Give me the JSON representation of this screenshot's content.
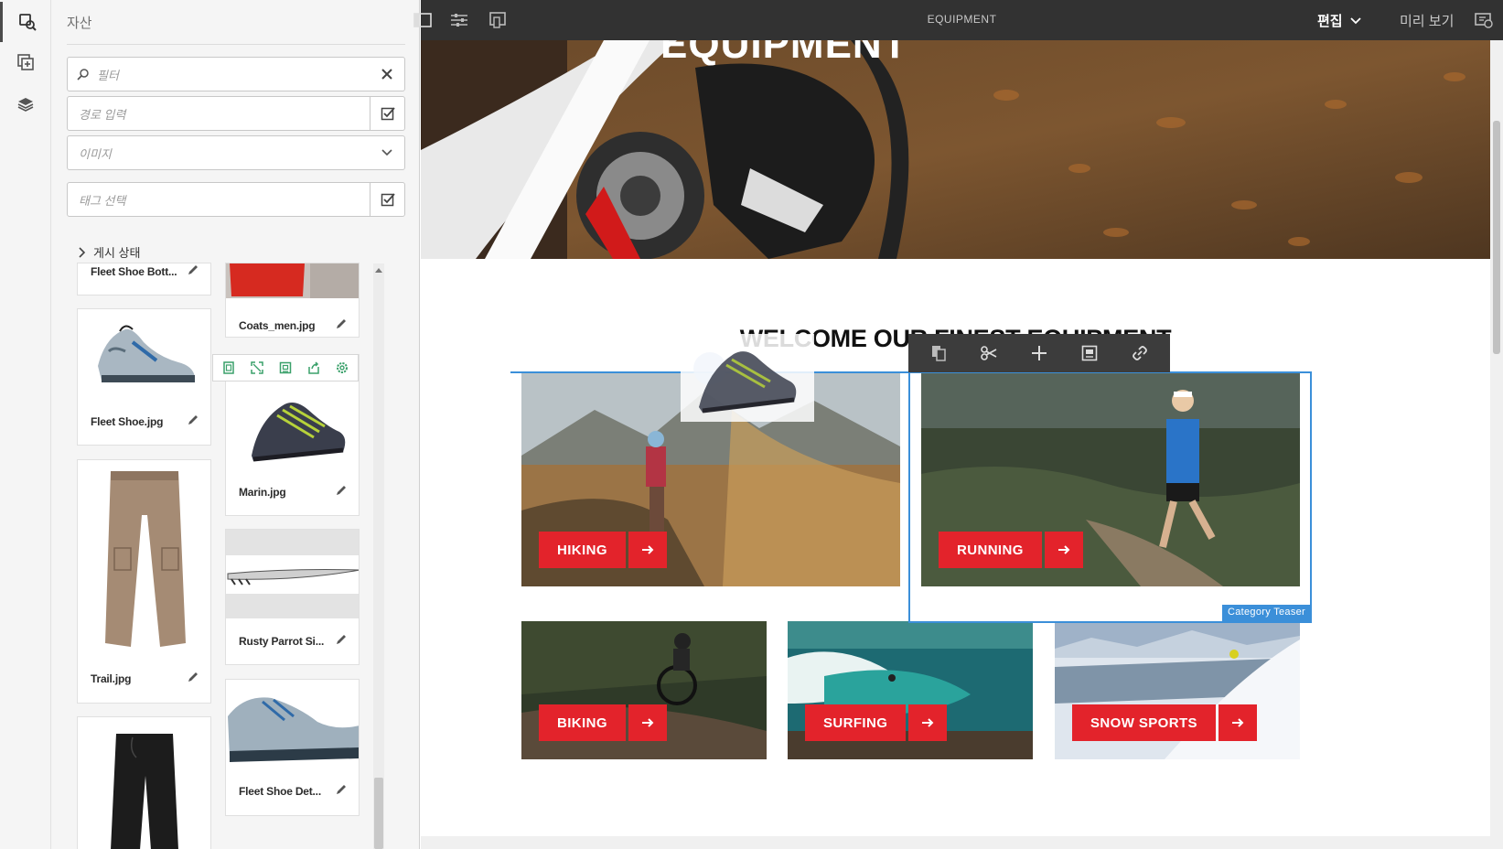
{
  "rail": {
    "items": [
      {
        "name": "assets-icon",
        "active": true
      },
      {
        "name": "components-icon",
        "active": false
      },
      {
        "name": "content-tree-icon",
        "active": false
      }
    ]
  },
  "panel": {
    "title": "자산",
    "filter_placeholder": "필터",
    "path_placeholder": "경로 입력",
    "type_select_value": "이미지",
    "tag_placeholder": "태그 선택",
    "publish_status_label": "게시 상태",
    "assets_left": [
      {
        "label": "Fleet Shoe Bott..."
      },
      {
        "label": "Fleet Shoe.jpg"
      },
      {
        "label": "Trail.jpg"
      },
      {
        "label": ""
      }
    ],
    "assets_right": [
      {
        "label": "Coats_men.jpg"
      },
      {
        "label": "Marin.jpg"
      },
      {
        "label": "Rusty Parrot Si..."
      },
      {
        "label": "Fleet Shoe Det..."
      }
    ]
  },
  "topbar": {
    "page_title": "EQUIPMENT",
    "mode_label": "편집",
    "preview_label": "미리 보기"
  },
  "page": {
    "hero_title": "EQUIPMENT",
    "section_title": "WELCOME OUR FINEST EQUIPMENT",
    "teasers": [
      {
        "label": "HIKING"
      },
      {
        "label": "RUNNING"
      },
      {
        "label": "BIKING"
      },
      {
        "label": "SURFING"
      },
      {
        "label": "SNOW SPORTS"
      }
    ],
    "selected_component_label": "Category Teaser"
  },
  "colors": {
    "accent_red": "#e3232b",
    "selection_blue": "#3b8fd9",
    "topbar_bg": "#323232"
  }
}
